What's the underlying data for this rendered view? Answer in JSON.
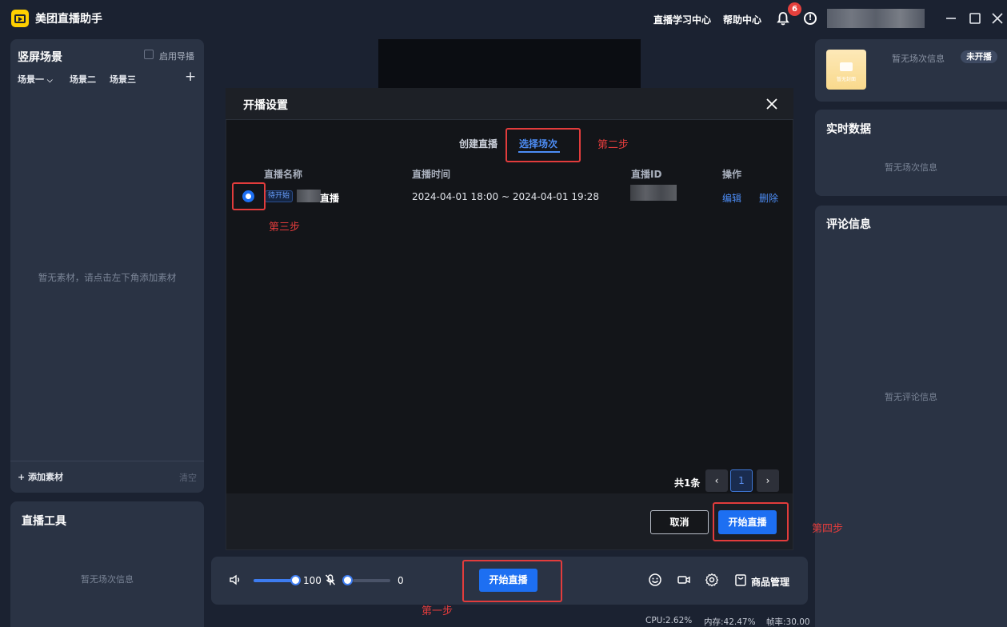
{
  "app": {
    "title": "美团直播助手"
  },
  "header": {
    "learning_center": "直播学习中心",
    "help_center": "帮助中心",
    "notification_count": "6"
  },
  "left_scene": {
    "title": "竖屏场景",
    "guide_toggle_label": "启用导播",
    "tabs": [
      "场景一",
      "场景二",
      "场景三"
    ],
    "empty_text": "暂无素材，请点击左下角添加素材",
    "add_material": "添加素材",
    "clear": "清空"
  },
  "left_tools": {
    "title": "直播工具",
    "empty_text": "暂无场次信息"
  },
  "right_session": {
    "cover_caption": "暂无封面",
    "info": "暂无场次信息",
    "status_badge": "未开播"
  },
  "right_realtime": {
    "title": "实时数据",
    "empty_text": "暂无场次信息"
  },
  "right_comments": {
    "title": "评论信息",
    "empty_text": "暂无评论信息"
  },
  "control_bar": {
    "volume_value": "100",
    "volume_level": 1.0,
    "mic_value": "0",
    "mic_level": 0.0,
    "start_live": "开始直播",
    "goods_manage": "商品管理"
  },
  "status_bar": {
    "cpu": "CPU:2.62%",
    "memory": "内存:42.47%",
    "frame_rate": "帧率:30.00"
  },
  "modal": {
    "title": "开播设置",
    "tabs": [
      "创建直播",
      "选择场次"
    ],
    "active_tab": "选择场次",
    "columns": [
      "直播名称",
      "直播时间",
      "直播ID",
      "操作"
    ],
    "rows": [
      {
        "status": "待开始",
        "name": "直播",
        "time": "2024-04-01 18:00 ~ 2024-04-01 19:28",
        "actions": [
          "编辑",
          "删除"
        ]
      }
    ],
    "total": "共1条",
    "current_page": "1",
    "cancel": "取消",
    "confirm": "开始直播"
  },
  "annotations": {
    "step1": "第一步",
    "step2": "第二步",
    "step3": "第三步",
    "step4": "第四步"
  },
  "colors": {
    "accent": "#1d6ff2",
    "annotation_red": "#e23c3c",
    "background": "#1b2231",
    "panel": "#2a3344"
  }
}
